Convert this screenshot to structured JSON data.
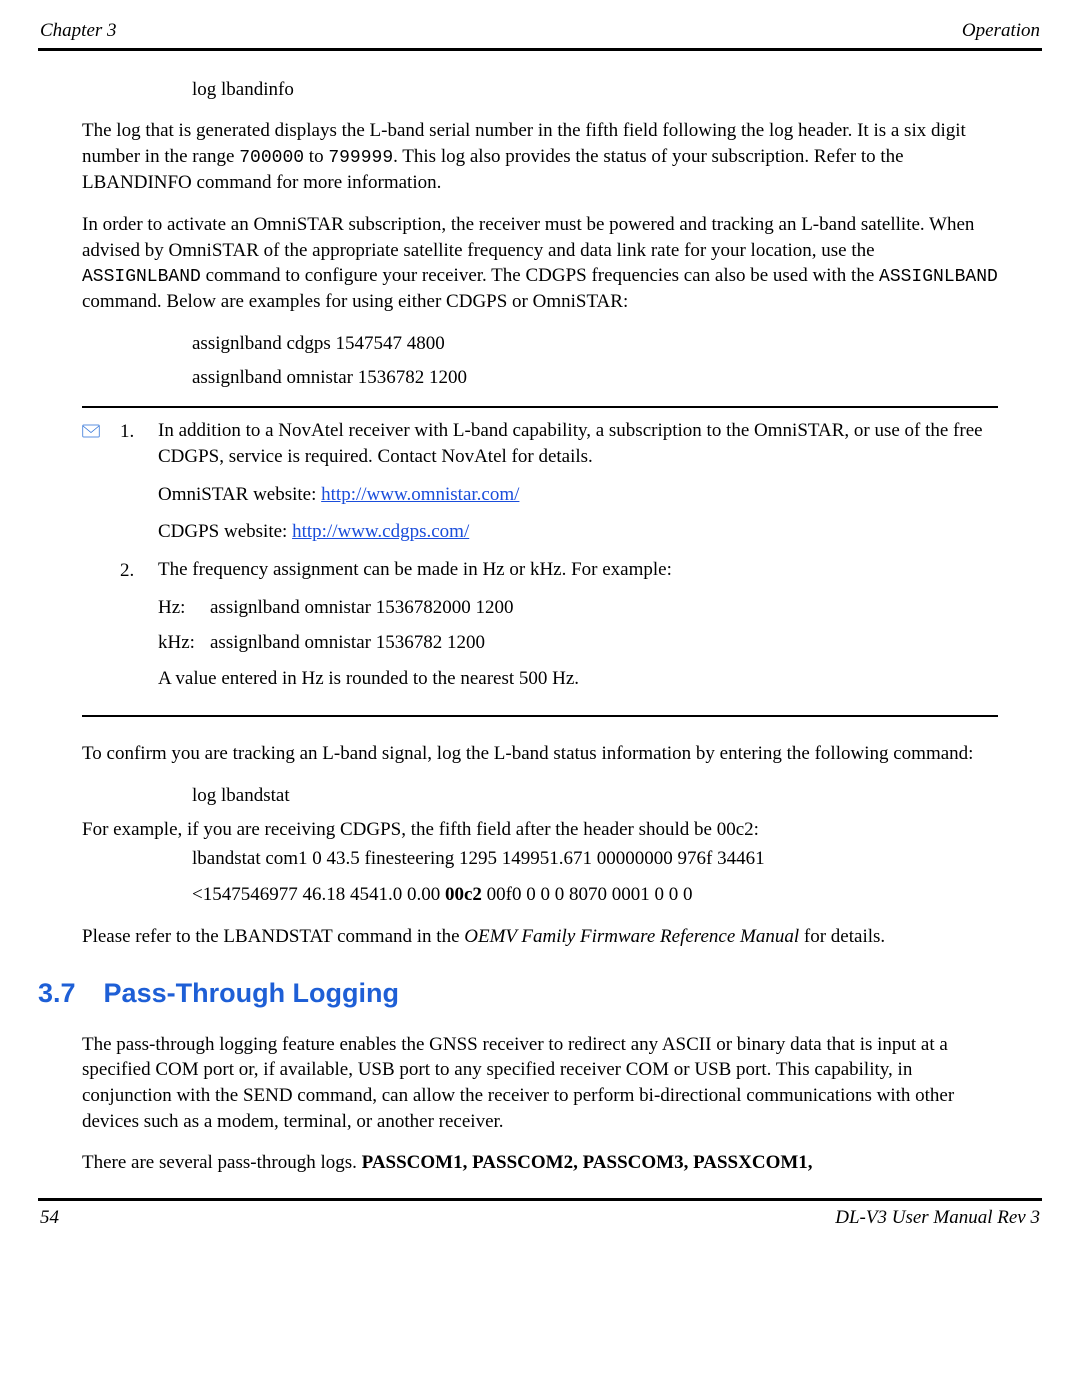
{
  "header": {
    "left": "Chapter 3",
    "right": "Operation"
  },
  "lines": {
    "cmd_lbandinfo": "log lbandinfo",
    "p1_a": "The log that is generated displays the L-band serial number in the fifth field following the log header. It is a six digit number in the range ",
    "p1_b": "700000",
    "p1_c": " to ",
    "p1_d": "799999",
    "p1_e": ". This log also provides the status of your subscription. Refer to the LBANDINFO command for more information.",
    "p2_a": "In order to activate an OmniSTAR subscription, the receiver must be powered and tracking an L-band satellite. When advised by OmniSTAR of the appropriate satellite frequency and data link rate for your location, use the ",
    "p2_b": "ASSIGNLBAND",
    "p2_c": " command to configure your receiver. The CDGPS frequencies can also be used with the ",
    "p2_d": "ASSIGNLBAND",
    "p2_e": " command. Below are examples for using either CDGPS or OmniSTAR:",
    "cmd_cdgps": "assignlband cdgps 1547547 4800",
    "cmd_omni": "assignlband omnistar 1536782 1200",
    "p3": "To confirm you are tracking an L-band signal, log the L-band status information by entering the following command:",
    "cmd_lbandstat": "log lbandstat",
    "p4": "For example, if you are receiving CDGPS, the fifth field after the header should be 00c2:",
    "lbs_line1": "lbandstat com1 0 43.5 finesteering 1295 149951.671 00000000 976f 34461",
    "lbs_line2a": "<1547546977 46.18 4541.0 0.00 ",
    "lbs_line2b": "00c2",
    "lbs_line2c": " 00f0 0 0 0 8070 0001 0 0 0",
    "p5a": "Please refer to the LBANDSTAT command in the ",
    "p5b": "OEMV Family Firmware Reference Manual",
    "p5c": " for details."
  },
  "note": {
    "n1": {
      "num": "1.",
      "body1": "In addition to a NovAtel receiver with L-band capability, a subscription to the OmniSTAR, or use of the free CDGPS, service is required. Contact NovAtel for details.",
      "omni_label": "OmniSTAR website: ",
      "omni_url": "http://www.omnistar.com/",
      "cdgps_label": "CDGPS website: ",
      "cdgps_url": "http://www.cdgps.com/"
    },
    "n2": {
      "num": "2.",
      "body1": "The frequency assignment can be made in Hz or kHz. For example:",
      "hz_label": "Hz:",
      "hz_val": "assignlband omnistar 1536782000 1200",
      "khz_label": "kHz:",
      "khz_val": "assignlband omnistar 1536782 1200",
      "body2": "A value entered in Hz is rounded to the nearest 500 Hz."
    }
  },
  "section": {
    "num": "3.7",
    "title": "Pass-Through Logging",
    "p1": "The pass-through logging feature enables the GNSS receiver to redirect any ASCII or binary data that is input at a specified COM port or, if available, USB port to any specified receiver COM or USB port. This capability, in conjunction with the SEND command, can allow the receiver to perform bi-directional communications with other devices such as a modem, terminal, or another receiver.",
    "p2a": "There are several pass-through logs. ",
    "p2b": "PASSCOM1, PASSCOM2, PASSCOM3, PASSXCOM1,"
  },
  "footer": {
    "page": "54",
    "right": "DL-V3 User Manual Rev 3"
  }
}
